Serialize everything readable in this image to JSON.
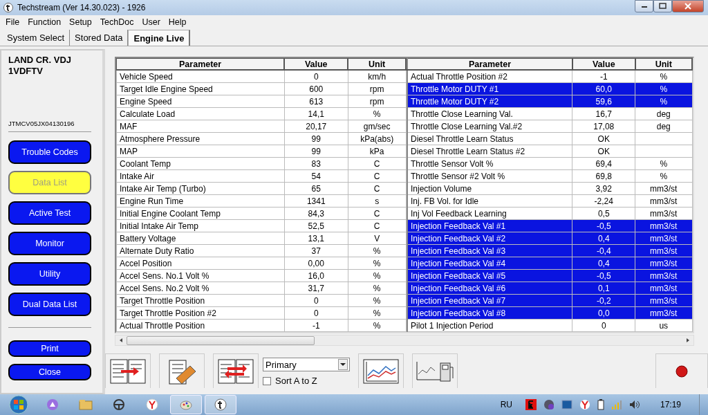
{
  "window": {
    "title": "Techstream (Ver 14.30.023) - 1926"
  },
  "menu": [
    "File",
    "Function",
    "Setup",
    "TechDoc",
    "User",
    "Help"
  ],
  "tabs": [
    {
      "label": "System Select",
      "selected": false
    },
    {
      "label": "Stored Data",
      "selected": false
    },
    {
      "label": "Engine Live",
      "selected": true
    }
  ],
  "vehicle": {
    "model": "LAND CR. VDJ",
    "engine": "1VDFTV",
    "vin": "JTMCV05JX04130196"
  },
  "sidebar": {
    "items": [
      {
        "label": "Trouble Codes",
        "selected": false
      },
      {
        "label": "Data List",
        "selected": true
      },
      {
        "label": "Active Test",
        "selected": false
      },
      {
        "label": "Monitor",
        "selected": false
      },
      {
        "label": "Utility",
        "selected": false
      },
      {
        "label": "Dual Data List",
        "selected": false
      }
    ],
    "bottom_buttons": [
      "Print",
      "Close"
    ]
  },
  "tables": [
    {
      "columns": [
        "Parameter",
        "Value",
        "Unit"
      ],
      "rows": [
        {
          "parameter": "Vehicle Speed",
          "value": "0",
          "unit": "km/h",
          "selected": false
        },
        {
          "parameter": "Target Idle Engine Speed",
          "value": "600",
          "unit": "rpm",
          "selected": false
        },
        {
          "parameter": "Engine Speed",
          "value": "613",
          "unit": "rpm",
          "selected": false
        },
        {
          "parameter": "Calculate Load",
          "value": "14,1",
          "unit": "%",
          "selected": false
        },
        {
          "parameter": "MAF",
          "value": "20,17",
          "unit": "gm/sec",
          "selected": false
        },
        {
          "parameter": "Atmosphere Pressure",
          "value": "99",
          "unit": "kPa(abs)",
          "selected": false
        },
        {
          "parameter": "MAP",
          "value": "99",
          "unit": "kPa",
          "selected": false
        },
        {
          "parameter": "Coolant Temp",
          "value": "83",
          "unit": "C",
          "selected": false
        },
        {
          "parameter": "Intake Air",
          "value": "54",
          "unit": "C",
          "selected": false
        },
        {
          "parameter": "Intake Air Temp (Turbo)",
          "value": "65",
          "unit": "C",
          "selected": false
        },
        {
          "parameter": "Engine Run Time",
          "value": "1341",
          "unit": "s",
          "selected": false
        },
        {
          "parameter": "Initial Engine Coolant Temp",
          "value": "84,3",
          "unit": "C",
          "selected": false
        },
        {
          "parameter": "Initial Intake Air Temp",
          "value": "52,5",
          "unit": "C",
          "selected": false
        },
        {
          "parameter": "Battery Voltage",
          "value": "13,1",
          "unit": "V",
          "selected": false
        },
        {
          "parameter": "Alternate Duty Ratio",
          "value": "37",
          "unit": "%",
          "selected": false
        },
        {
          "parameter": "Accel Position",
          "value": "0,00",
          "unit": "%",
          "selected": false
        },
        {
          "parameter": "Accel Sens. No.1 Volt %",
          "value": "16,0",
          "unit": "%",
          "selected": false
        },
        {
          "parameter": "Accel Sens. No.2 Volt %",
          "value": "31,7",
          "unit": "%",
          "selected": false
        },
        {
          "parameter": "Target Throttle Position",
          "value": "0",
          "unit": "%",
          "selected": false
        },
        {
          "parameter": "Target Throttle Position #2",
          "value": "0",
          "unit": "%",
          "selected": false
        },
        {
          "parameter": "Actual Throttle Position",
          "value": "-1",
          "unit": "%",
          "selected": false
        }
      ]
    },
    {
      "columns": [
        "Parameter",
        "Value",
        "Unit"
      ],
      "rows": [
        {
          "parameter": "Actual Throttle Position #2",
          "value": "-1",
          "unit": "%",
          "selected": false
        },
        {
          "parameter": "Throttle Motor DUTY #1",
          "value": "60,0",
          "unit": "%",
          "selected": true
        },
        {
          "parameter": "Throttle Motor DUTY #2",
          "value": "59,6",
          "unit": "%",
          "selected": true
        },
        {
          "parameter": "Throttle Close Learning Val.",
          "value": "16,7",
          "unit": "deg",
          "selected": false
        },
        {
          "parameter": "Throttle Close Learning Val.#2",
          "value": "17,08",
          "unit": "deg",
          "selected": false
        },
        {
          "parameter": "Diesel Throttle Learn Status",
          "value": "OK",
          "selected": false
        },
        {
          "parameter": "Diesel Throttle Learn Status #2",
          "value": "OK",
          "selected": false
        },
        {
          "parameter": "Throttle Sensor Volt %",
          "value": "69,4",
          "unit": "%",
          "selected": false
        },
        {
          "parameter": "Throttle Sensor #2 Volt %",
          "value": "69,8",
          "unit": "%",
          "selected": false
        },
        {
          "parameter": "Injection Volume",
          "value": "3,92",
          "unit": "mm3/st",
          "selected": false
        },
        {
          "parameter": "Inj. FB Vol. for Idle",
          "value": "-2,24",
          "unit": "mm3/st",
          "selected": false
        },
        {
          "parameter": "Inj Vol Feedback Learning",
          "value": "0,5",
          "unit": "mm3/st",
          "selected": false
        },
        {
          "parameter": "Injection Feedback Val #1",
          "value": "-0,5",
          "unit": "mm3/st",
          "selected": true
        },
        {
          "parameter": "Injection Feedback Val #2",
          "value": "0,4",
          "unit": "mm3/st",
          "selected": true
        },
        {
          "parameter": "Injection Feedback Val #3",
          "value": "-0,4",
          "unit": "mm3/st",
          "selected": true
        },
        {
          "parameter": "Injection Feedback Val #4",
          "value": "0,4",
          "unit": "mm3/st",
          "selected": true
        },
        {
          "parameter": "Injection Feedback Val #5",
          "value": "-0,5",
          "unit": "mm3/st",
          "selected": true
        },
        {
          "parameter": "Injection Feedback Val #6",
          "value": "0,1",
          "unit": "mm3/st",
          "selected": true
        },
        {
          "parameter": "Injection Feedback Val #7",
          "value": "-0,2",
          "unit": "mm3/st",
          "selected": true
        },
        {
          "parameter": "Injection Feedback Val #8",
          "value": "0,0",
          "unit": "mm3/st",
          "selected": true
        },
        {
          "parameter": "Pilot 1 Injection Period",
          "value": "0",
          "unit": "us",
          "selected": false
        }
      ]
    }
  ],
  "toolbar": {
    "dropdown": {
      "value": "Primary"
    },
    "sort_checkbox": {
      "label": "Sort A to Z",
      "checked": false
    }
  },
  "taskbar": {
    "language": "RU",
    "time": "17:19"
  }
}
